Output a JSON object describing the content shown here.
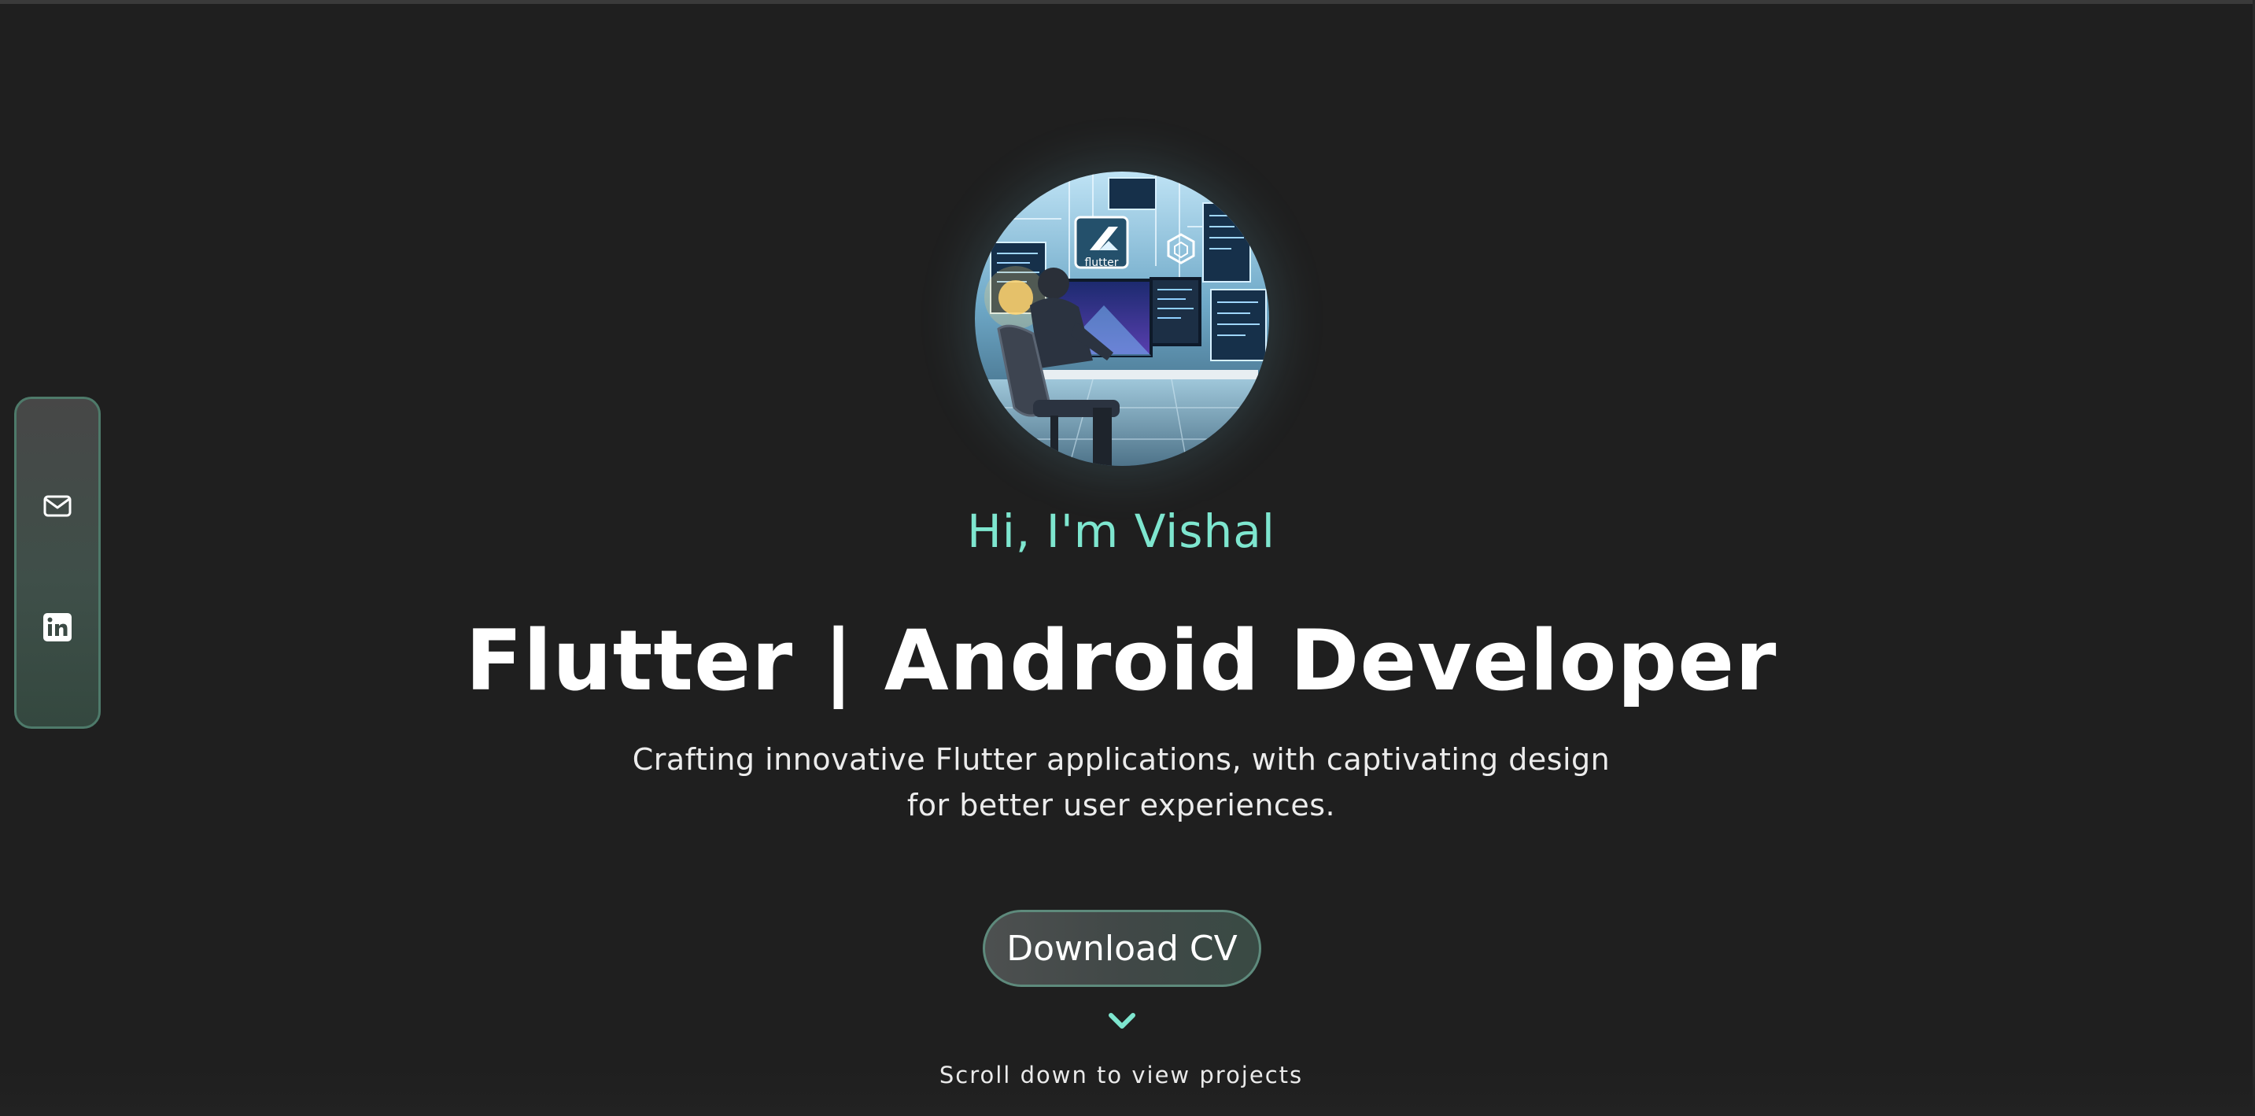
{
  "hero": {
    "greeting": "Hi, I'm Vishal",
    "headline": "Flutter | Android Developer",
    "tagline": "Crafting innovative Flutter applications, with captivating design for better user experiences.",
    "cta_label": "Download CV",
    "scroll_hint": "Scroll down to view projects",
    "avatar_subject": "developer at desk with flutter screens",
    "avatar_logo_text": "flutter"
  },
  "social": {
    "items": [
      {
        "name": "email",
        "icon": "mail-icon"
      },
      {
        "name": "linkedin",
        "icon": "linkedin-icon"
      }
    ]
  },
  "colors": {
    "background": "#1f1f1f",
    "accent": "#7ee6cf",
    "border_accent": "#4e7a6a",
    "text": "#ffffff"
  }
}
